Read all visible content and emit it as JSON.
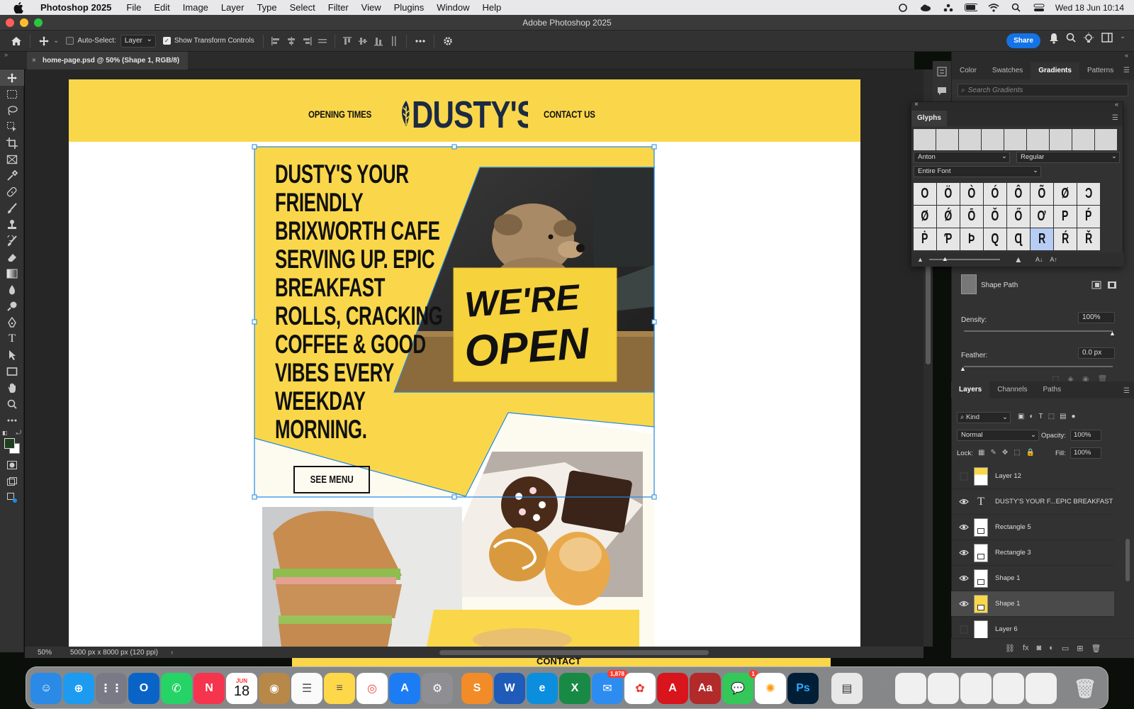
{
  "menubar": {
    "app_name": "Photoshop 2025",
    "menus": [
      "File",
      "Edit",
      "Image",
      "Layer",
      "Type",
      "Select",
      "Filter",
      "View",
      "Plugins",
      "Window",
      "Help"
    ],
    "clock": "Wed 18 Jun  10:14"
  },
  "window": {
    "title": "Adobe Photoshop 2025"
  },
  "options_bar": {
    "auto_select_label": "Auto-Select:",
    "auto_select_value": "Layer",
    "show_transform_label": "Show Transform Controls",
    "share_label": "Share"
  },
  "document": {
    "tab_title": "home-page.psd @ 50% (Shape 1, RGB/8)",
    "zoom": "50%",
    "dimensions": "5000 px x 8000 px (120 ppi)"
  },
  "design": {
    "nav_left": "OPENING TIMES",
    "logo_text": "DUSTY'S",
    "nav_right": "CONTACT US",
    "headline": "DUSTY'S YOUR FRIENDLY BRIXWORTH CAFE SERVING UP. EPIC BREAKFAST ROLLS, CRACKING COFFEE & GOOD VIBES EVERY WEEKDAY MORNING.",
    "sign_line1": "WE'RE",
    "sign_line2": "OPEN",
    "cta": "SEE MENU",
    "below_fold": "CONTACT",
    "colors": {
      "brand_yellow": "#fad74a",
      "cream": "#fdfaf0",
      "selection": "#1e88e5",
      "ink": "#111111"
    }
  },
  "panels": {
    "top_tabs": [
      "Color",
      "Swatches",
      "Gradients",
      "Patterns"
    ],
    "active_top_tab": "Gradients",
    "search_placeholder": "Search Gradients",
    "glyphs": {
      "title": "Glyphs",
      "font": "Anton",
      "style": "Regular",
      "scope": "Entire Font",
      "rows": [
        [
          "O",
          "Ö",
          "Ò",
          "Ó",
          "Ô",
          "Õ",
          "Ø",
          "Ɔ"
        ],
        [
          "Ø",
          "Ǿ",
          "Ō",
          "Ŏ",
          "Ő",
          "Ơ",
          "P",
          "Ṕ"
        ],
        [
          "Ṗ",
          "Ƥ",
          "Þ",
          "Q",
          "Ɋ",
          "R",
          "Ŕ",
          "Ř"
        ]
      ],
      "selected": "R"
    },
    "properties": {
      "shape_path_label": "Shape Path",
      "density_label": "Density:",
      "density_value": "100%",
      "density_fraction": 1.0,
      "feather_label": "Feather:",
      "feather_value": "0.0 px"
    },
    "layers": {
      "tabs": [
        "Layers",
        "Channels",
        "Paths"
      ],
      "filter": "Kind",
      "blend_mode": "Normal",
      "opacity_label": "Opacity:",
      "opacity": "100%",
      "lock_label": "Lock:",
      "fill_label": "Fill:",
      "fill": "100%",
      "items": [
        {
          "name": "Layer 12",
          "visible": false,
          "kind": "pixel",
          "selected": false
        },
        {
          "name": "DUSTY'S YOUR F...EPIC BREAKFAST",
          "visible": true,
          "kind": "text",
          "selected": false
        },
        {
          "name": "Rectangle 5",
          "visible": true,
          "kind": "shape",
          "selected": false
        },
        {
          "name": "Rectangle 3",
          "visible": true,
          "kind": "shape",
          "selected": false
        },
        {
          "name": "Shape 1",
          "visible": true,
          "kind": "shape",
          "selected": false
        },
        {
          "name": "Shape 1",
          "visible": true,
          "kind": "shape",
          "selected": true
        },
        {
          "name": "Layer 6",
          "visible": false,
          "kind": "pixel",
          "selected": false
        }
      ]
    }
  },
  "dock": {
    "calendar_month": "JUN",
    "calendar_day": "18",
    "mail_badge": "1,878",
    "messages_badge": "1"
  }
}
